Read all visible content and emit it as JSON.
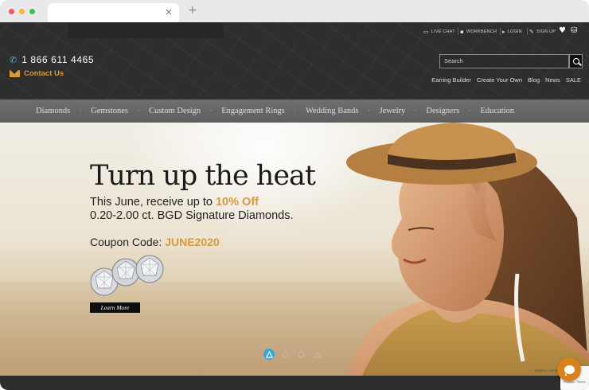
{
  "browser": {
    "tab_close": "×",
    "new_tab": "+"
  },
  "header": {
    "utility_links": [
      {
        "label": "LIVE CHAT",
        "icon": "chat-icon"
      },
      {
        "label": "WORKBENCH",
        "icon": "workbench-icon"
      },
      {
        "label": "LOGIN",
        "icon": "login-icon"
      },
      {
        "label": "SIGN UP",
        "icon": "signup-icon"
      }
    ],
    "phone": "1  866  611 4465",
    "contact_label": "Contact Us",
    "search_placeholder": "Search",
    "sub_links": [
      "Earring Builder",
      "Create Your Own",
      "Blog",
      "News",
      "SALE"
    ]
  },
  "nav": {
    "items": [
      "Diamonds",
      "Gemstones",
      "Custom Design",
      "Engagement Rings",
      "Wedding Bands",
      "Jewelry",
      "Designers",
      "Education"
    ]
  },
  "hero": {
    "title": "Turn up the heat",
    "line1_prefix": "This June, receive up to ",
    "line1_accent": "10% Off",
    "line2": "0.20-2.00 ct. BGD Signature Diamonds.",
    "coupon_prefix": "Coupon Code: ",
    "coupon_code": "JUNE2020",
    "cta_label": "Learn More",
    "fine_print": "TERMS & CONDITIONS",
    "slides": 4,
    "active_slide": 1
  },
  "recaptcha_text": "Privacy - Terms",
  "colors": {
    "accent_gold": "#d69a3b",
    "header_bg": "#2e2e2e",
    "nav_bg": "#666666",
    "pager_active": "#3aa7d8",
    "chat_orange": "#d8821f"
  }
}
